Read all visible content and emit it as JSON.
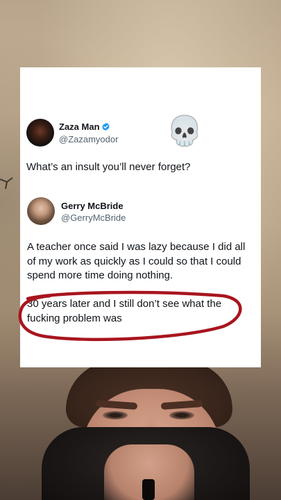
{
  "original_tweet": {
    "author_name": "Zaza Man",
    "author_handle": "@Zazamyodor",
    "verified": true,
    "text": "What’s an insult you’ll never forget?",
    "reaction_emoji": "💀",
    "reaction_icon": "skull-emoji"
  },
  "reply_tweet": {
    "author_name": "Gerry McBride",
    "author_handle": "@GerryMcBride",
    "paragraph_1": "A teacher once said I was lazy because I did all of my work as quickly as I could so that I could spend more time doing nothing.",
    "paragraph_2": "30 years later and I still don’t see what the fucking problem was"
  },
  "colors": {
    "verified_badge": "#1d9bf0",
    "annotation_circle": "#a8151e",
    "text_primary": "#0f1419",
    "text_secondary": "#536471"
  }
}
